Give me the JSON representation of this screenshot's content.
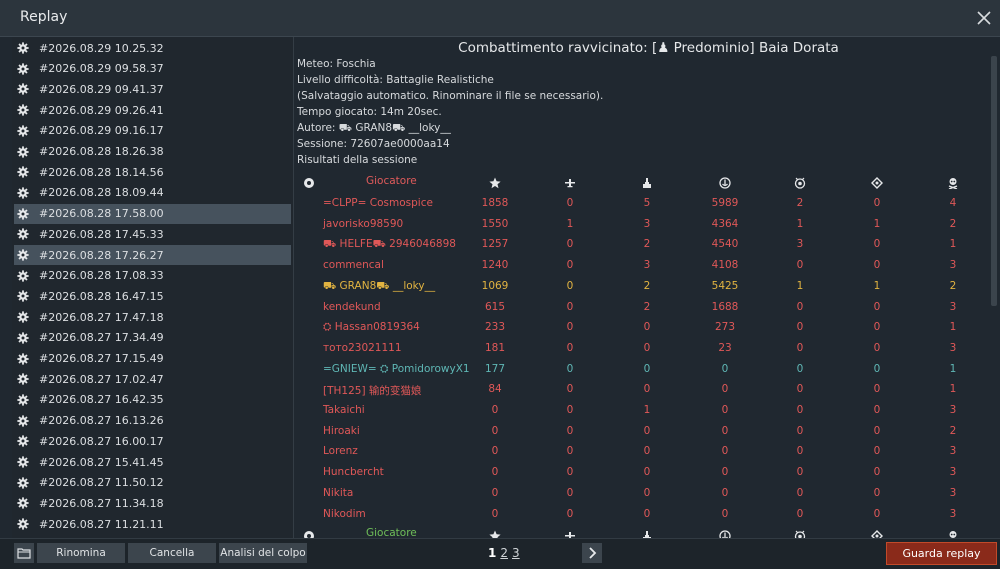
{
  "window": {
    "title": "Replay"
  },
  "replays": [
    "#2026.08.29 10.25.32",
    "#2026.08.29 09.58.37",
    "#2026.08.29 09.41.37",
    "#2026.08.29 09.26.41",
    "#2026.08.29 09.16.17",
    "#2026.08.28 18.26.38",
    "#2026.08.28 18.14.56",
    "#2026.08.28 18.09.44",
    "#2026.08.28 17.58.00",
    "#2026.08.28 17.45.33",
    "#2026.08.28 17.26.27",
    "#2026.08.28 17.08.33",
    "#2026.08.28 16.47.15",
    "#2026.08.27 17.47.18",
    "#2026.08.27 17.34.49",
    "#2026.08.27 17.15.49",
    "#2026.08.27 17.02.47",
    "#2026.08.27 16.42.35",
    "#2026.08.27 16.13.26",
    "#2026.08.27 16.00.17",
    "#2026.08.27 15.41.45",
    "#2026.08.27 11.50.12",
    "#2026.08.27 11.34.18",
    "#2026.08.27 11.21.11"
  ],
  "selected_index": 8,
  "highlighted_index": 10,
  "info": {
    "title": "Combattimento ravvicinato: [♟ Predominio] Baia Dorata",
    "lines": [
      "Meteo: Foschia",
      "Livello difficoltà: Battaglie Realistiche",
      "(Salvataggio automatico. Rinominare il file se necessario).",
      "Tempo giocato: 14m 20sec.",
      "Autore: ⛟ GRAN8⛟ __loky__",
      "Sessione: 72607ae0000aa14",
      "Risultati della sessione"
    ]
  },
  "table": {
    "player_header": "Giocatore",
    "player_header_bottom": "Giocatore",
    "column_icons": [
      "team-icon",
      "score-star-icon",
      "air-kills-icon",
      "ground-kills-icon",
      "naval-kills-icon",
      "assists-icon",
      "captures-icon",
      "deaths-icon"
    ],
    "rows": [
      {
        "name": "=CLPP= Cosmospice",
        "color": "red",
        "vals": [
          "1858",
          "0",
          "5",
          "5989",
          "2",
          "0",
          "4"
        ]
      },
      {
        "name": "javorisko98590",
        "color": "red",
        "vals": [
          "1550",
          "1",
          "3",
          "4364",
          "1",
          "1",
          "2"
        ]
      },
      {
        "name": "⛟ HELFE⛟ 2946046898",
        "color": "red",
        "vals": [
          "1257",
          "0",
          "2",
          "4540",
          "3",
          "0",
          "1"
        ]
      },
      {
        "name": "commencal",
        "color": "red",
        "vals": [
          "1240",
          "0",
          "3",
          "4108",
          "0",
          "0",
          "3"
        ]
      },
      {
        "name": "⛟ GRAN8⛟ __loky__",
        "color": "gold",
        "vals": [
          "1069",
          "0",
          "2",
          "5425",
          "1",
          "1",
          "2"
        ]
      },
      {
        "name": "kendekund",
        "color": "red",
        "vals": [
          "615",
          "0",
          "2",
          "1688",
          "0",
          "0",
          "3"
        ]
      },
      {
        "name": "⛭ Hassan0819364",
        "color": "red",
        "vals": [
          "233",
          "0",
          "0",
          "273",
          "0",
          "0",
          "1"
        ]
      },
      {
        "name": "тото23021111",
        "color": "red",
        "vals": [
          "181",
          "0",
          "0",
          "23",
          "0",
          "0",
          "3"
        ]
      },
      {
        "name": "=GNIEW= ⛭ PomidorowyX1",
        "color": "teal",
        "vals": [
          "177",
          "0",
          "0",
          "0",
          "0",
          "0",
          "1"
        ]
      },
      {
        "name": "[TH125] 输的变猫娘",
        "color": "red",
        "vals": [
          "84",
          "0",
          "0",
          "0",
          "0",
          "0",
          "1"
        ]
      },
      {
        "name": "Takaichi",
        "color": "red",
        "vals": [
          "0",
          "0",
          "1",
          "0",
          "0",
          "0",
          "3"
        ]
      },
      {
        "name": "Hiroaki",
        "color": "red",
        "vals": [
          "0",
          "0",
          "0",
          "0",
          "0",
          "0",
          "2"
        ]
      },
      {
        "name": "Lorenz",
        "color": "red",
        "vals": [
          "0",
          "0",
          "0",
          "0",
          "0",
          "0",
          "3"
        ]
      },
      {
        "name": "Huncbercht",
        "color": "red",
        "vals": [
          "0",
          "0",
          "0",
          "0",
          "0",
          "0",
          "3"
        ]
      },
      {
        "name": "Nikita",
        "color": "red",
        "vals": [
          "0",
          "0",
          "0",
          "0",
          "0",
          "0",
          "3"
        ]
      },
      {
        "name": "Nikodim",
        "color": "red",
        "vals": [
          "0",
          "0",
          "0",
          "0",
          "0",
          "0",
          "3"
        ]
      }
    ]
  },
  "buttons": {
    "folder_icon": "folder-icon",
    "rename": "Rinomina",
    "delete": "Cancella",
    "hit_analysis": "Analisi del colpo",
    "next_icon": "chevron-right-icon",
    "watch": "Guarda replay"
  },
  "pagination": [
    "1",
    "2",
    "3"
  ],
  "current_page": "1",
  "colors": {
    "red": "#e05858",
    "gold": "#e1b341",
    "teal": "#5fb7b5",
    "green": "#6fbf59",
    "accent": "#8a2a1a"
  }
}
